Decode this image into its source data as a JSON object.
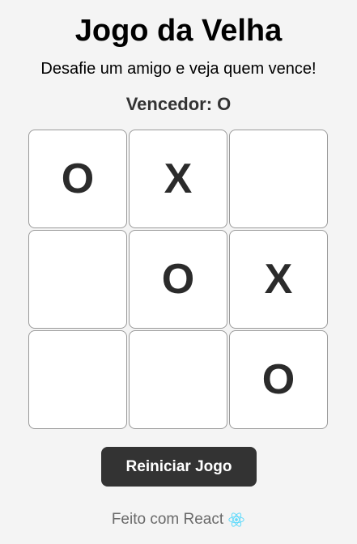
{
  "header": {
    "title": "Jogo da Velha",
    "subtitle": "Desafie um amigo e veja quem vence!"
  },
  "status": {
    "text": "Vencedor: O"
  },
  "board": {
    "cells": [
      "O",
      "X",
      "",
      "",
      "O",
      "X",
      "",
      "",
      "O"
    ]
  },
  "controls": {
    "reset_label": "Reiniciar Jogo"
  },
  "footer": {
    "text": "Feito com React",
    "icon": "react-icon",
    "icon_color": "#61dafb"
  },
  "colors": {
    "background": "#f4f4f4",
    "cell_background": "#ffffff",
    "cell_border": "#9a9a9a",
    "mark": "#2b2b2b",
    "button_background": "#333333",
    "button_text": "#ffffff",
    "footer_text": "#6a6a6a"
  }
}
